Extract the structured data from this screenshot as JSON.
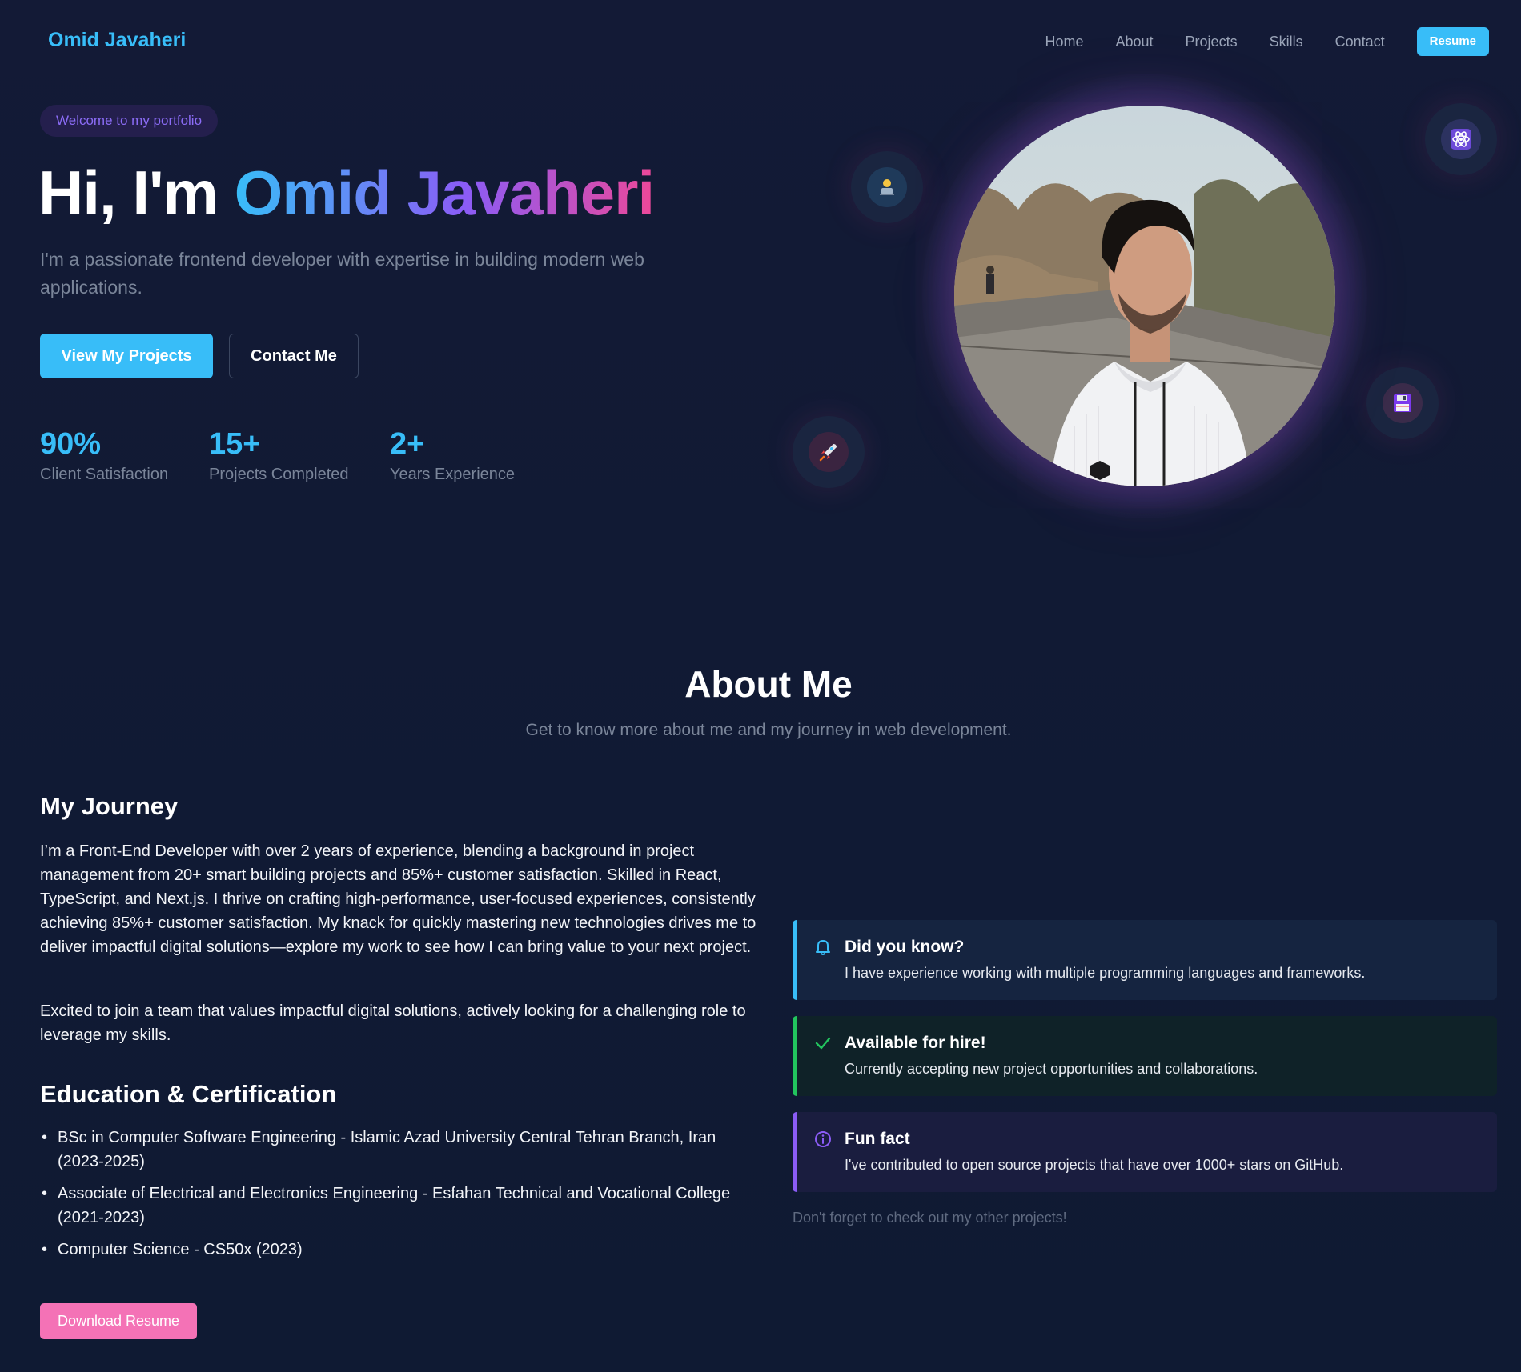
{
  "nav": {
    "brand": "Omid Javaheri",
    "links": [
      "Home",
      "About",
      "Projects",
      "Skills",
      "Contact"
    ],
    "resume": "Resume"
  },
  "hero": {
    "badge": "Welcome to my portfolio",
    "title_prefix": "Hi, I'm ",
    "title_name": "Omid Javaheri",
    "subtitle": "I'm a passionate frontend developer with expertise in building modern web applications.",
    "primary_button": "View My Projects",
    "secondary_button": "Contact Me",
    "stats": [
      {
        "value": "90%",
        "label": "Client Satisfaction"
      },
      {
        "value": "15+",
        "label": "Projects Completed"
      },
      {
        "value": "2+",
        "label": "Years Experience"
      }
    ],
    "floating_icons": [
      "developer-icon",
      "atom-icon",
      "rocket-icon",
      "floppy-disk-icon"
    ]
  },
  "about": {
    "title": "About Me",
    "subtitle": "Get to know more about me and my journey in web development.",
    "journey_heading": "My Journey",
    "journey_p1": "I’m a Front-End Developer with over 2 years of experience, blending a background in project management from 20+ smart building projects and 85%+ customer satisfaction. Skilled in React, TypeScript, and Next.js. I thrive on crafting high-performance, user-focused experiences, consistently achieving 85%+ customer satisfaction. My knack for quickly mastering new technologies drives me to deliver impactful digital solutions—explore my work to see how I can bring value to your next project.",
    "journey_p2": "Excited to join a team that values impactful digital solutions, actively looking for a challenging role to leverage my skills.",
    "education_heading": "Education & Certification",
    "education": [
      "BSc in Computer Software Engineering - Islamic Azad University Central Tehran Branch, Iran (2023-2025)",
      "Associate of Electrical and Electronics Engineering - Esfahan Technical and Vocational College (2021-2023)",
      "Computer Science - CS50x (2023)"
    ],
    "download_button": "Download Resume",
    "cards": [
      {
        "title": "Did you know?",
        "body": "I have experience working with multiple programming languages and frameworks.",
        "icon": "bell-icon",
        "accent": "#38bdf8",
        "bg": "#152440"
      },
      {
        "title": "Available for hire!",
        "body": "Currently accepting new project opportunities and collaborations.",
        "icon": "check-icon",
        "accent": "#22c55e",
        "bg": "#0f2228"
      },
      {
        "title": "Fun fact",
        "body": "I've contributed to open source projects that have over 1000+ stars on GitHub.",
        "icon": "info-icon",
        "accent": "#8b5cf6",
        "bg": "#1a1d3f"
      }
    ],
    "footnote": "Don't forget to check out my other projects!"
  },
  "colors": {
    "accent": "#38bdf8",
    "purple": "#8b5cf6",
    "pink": "#ec4899",
    "background": "#101a33"
  }
}
